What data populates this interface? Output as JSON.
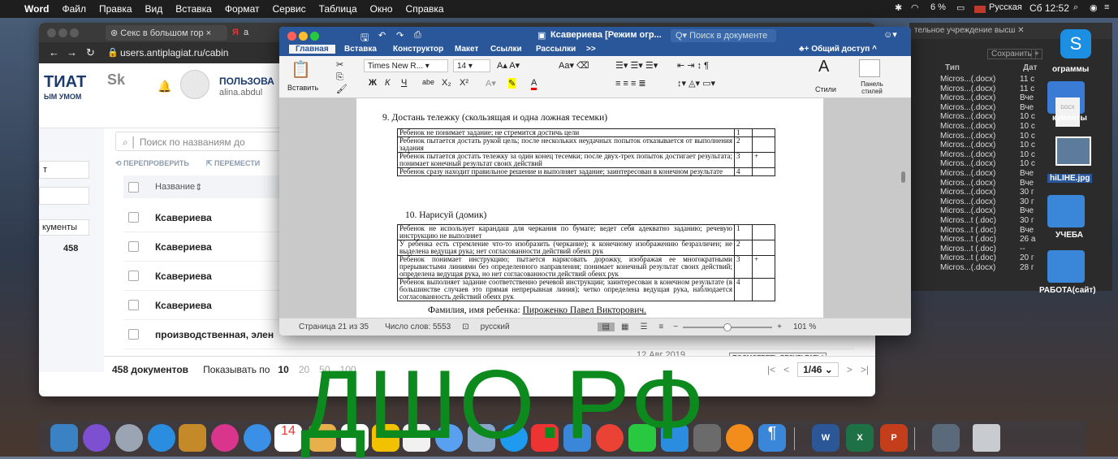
{
  "menubar": {
    "app": "Word",
    "items": [
      "Файл",
      "Правка",
      "Вид",
      "Вставка",
      "Формат",
      "Сервис",
      "Таблица",
      "Окно",
      "Справка"
    ],
    "battery": "6 %",
    "input_source": "Русская",
    "clock": "Сб 12:52"
  },
  "browser": {
    "tab_title": "Секс в большом гор",
    "tab2_initial": "а",
    "url": "users.antiplagiat.ru/cabin",
    "logo_text": "ТИАТ",
    "logo_sub": "ЫМ УМОМ",
    "sk_logo": "Sk",
    "user_label": "ПОЛЬЗОВА",
    "user_email": "alina.abdul",
    "search_placeholder": "Поиск по названиям до",
    "action_recheck": "ПЕРЕПРОВЕРИТЬ",
    "action_move": "ПЕРЕМЕСТИ",
    "left_t": "т",
    "left_docs": "кументы",
    "left_count": "458",
    "col_name": "Название",
    "rows": [
      "Ксавериева",
      "Ксавериева",
      "Ксавериева",
      "Ксавериева",
      "производственная, элен"
    ],
    "hidden_row_date": "12 Авг 2019",
    "hidden_row_button": "ПОСМОТРЕТЬ РЕЗУЛЬТАТЫ",
    "footer_total": "458 документов",
    "footer_show": "Показывать по",
    "page_sizes": [
      "10",
      "20",
      "50",
      "100"
    ],
    "pager": "1/46"
  },
  "word": {
    "doc_title": "Ксавериева [Режим огр...",
    "search_placeholder": "Поиск в документе",
    "ribbon_tabs": [
      "Главная",
      "Вставка",
      "Конструктор",
      "Макет",
      "Ссылки",
      "Рассылки",
      ">>"
    ],
    "share": "Общий доступ",
    "paste_label": "Вставить",
    "font_name": "Times New R...",
    "font_size": "14",
    "styles_label": "Стили",
    "styles_pane": "Панель стилей",
    "section9_title": "9. Достань тележку (скользящая и одна ложная тесемки)",
    "section9_rows": [
      {
        "text": "Ребенок не понимает задание; не стремится достичь цели",
        "score": "1",
        "mark": ""
      },
      {
        "text": "Ребенок пытается достать рукой цель; после нескольких неудачных попыток отказывается от выполнения задания",
        "score": "2",
        "mark": ""
      },
      {
        "text": "Ребенок пытается достать тележку за один конец тесемки; после двух-трех попыток достигает результата; понимает конечный результат своих действий",
        "score": "3",
        "mark": "+"
      },
      {
        "text": "Ребенок сразу находит правильное решение и выполняет задание; заинтересован в конечном результате",
        "score": "4",
        "mark": ""
      }
    ],
    "section10_title": "10. Нарисуй (домик)",
    "section10_rows": [
      {
        "text": "Ребенок не использует карандаш для черкания по бумаге; ведет себя адекватно заданию; речевую инструкцию не выполняет",
        "score": "1",
        "mark": ""
      },
      {
        "text": "У ребенка есть стремление что-то изобразить (черкание); к конечному изображению безразличен; не выделена ведущая рука; нет согласованности действий обеих рук",
        "score": "2",
        "mark": ""
      },
      {
        "text": "Ребенок понимает инструкцию; пытается нарисовать дорожку, изображая ее многократными прерывистыми линиями без определенного направления; понимает конечный результат своих действий; определена ведущая рука, но нет согласованности действий обеих рук",
        "score": "3",
        "mark": "+"
      },
      {
        "text": "Ребенок выполняет задание соответственно речевой инструкции; заинтересован в конечном результате (в большинстве случаев это прямая непрерывная линия); четко определена ведущая рука, наблюдается согласованность действий обеих рук",
        "score": "4",
        "mark": ""
      }
    ],
    "child_name_label": "Фамилия, имя ребенка:",
    "child_name": "Пироженко Павел Викторович.",
    "status_page": "Страница 21 из 35",
    "status_words": "Число слов: 5553",
    "status_lang": "русский",
    "zoom": "101 %"
  },
  "finder": {
    "partial_title": "тельное учреждение высш",
    "save_label": "Сохранить",
    "col_type": "Тип",
    "col_date": "Дат",
    "rows": [
      [
        "Micros...(.docx)",
        "11 с"
      ],
      [
        "Micros...(.docx)",
        "11 с"
      ],
      [
        "Micros...(.docx)",
        "Вче"
      ],
      [
        "Micros...(.docx)",
        "Вче"
      ],
      [
        "Micros...(.docx)",
        "10 с"
      ],
      [
        "Micros...(.docx)",
        "10 с"
      ],
      [
        "Micros...(.docx)",
        "10 с"
      ],
      [
        "Micros...(.docx)",
        "10 с"
      ],
      [
        "Micros...(.docx)",
        "10 с"
      ],
      [
        "Micros...(.docx)",
        "10 с"
      ],
      [
        "Micros...(.docx)",
        "Вче"
      ],
      [
        "Micros...(.docx)",
        "Вче"
      ],
      [
        "Micros...(.docx)",
        "30 г"
      ],
      [
        "Micros...(.docx)",
        "30 г"
      ],
      [
        "Micros...(.docx)",
        "Вче"
      ],
      [
        "Micros...t (.doc)",
        "30 г"
      ],
      [
        "Micros...t (.doc)",
        "Вче"
      ],
      [
        "Micros...t (.doc)",
        "26 а"
      ],
      [
        "Micros...t (.doc)",
        "--"
      ],
      [
        "Micros...t (.doc)",
        "20 г"
      ],
      [
        "Micros...(.docx)",
        "28 г"
      ]
    ]
  },
  "desktop_labels": {
    "programs": "ограммы",
    "docs": "кументы",
    "jpg": "hiLIHE.jpg",
    "ucheba": "УЧЕБА",
    "rabota": "РАБОТА(сайт)",
    "docx_icon": "DOCX"
  },
  "watermark": "ДШО.РФ",
  "colors": {
    "word_blue": "#2a579a",
    "watermark_green": "#0d8a1e",
    "accent_red": "#ff3b30"
  }
}
